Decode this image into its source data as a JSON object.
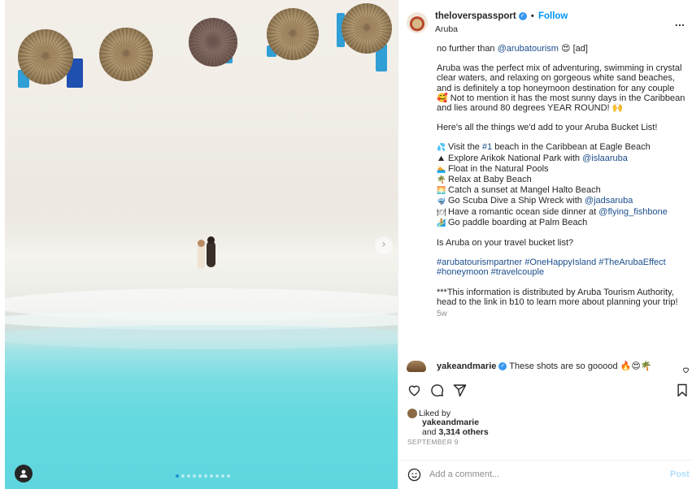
{
  "post": {
    "username": "theloverspassport",
    "follow_label": "Follow",
    "location": "Aruba",
    "more_label": "...",
    "separator": "•"
  },
  "caption": {
    "line0_pre": "no further than ",
    "line0_mention": "@arubatourism",
    "line0_emoji": "😍",
    "line0_post": " [ad]",
    "para1": "Aruba was the perfect mix of adventuring, swimming in crystal clear waters, and relaxing on gorgeous white sand beaches, and is definitely a top honeymoon destination for any couple 🥰 Not to mention it has the most sunny days in the Caribbean and lies around 80 degrees YEAR ROUND! 🙌",
    "para2": "Here's all the things we'd add to your Aruba Bucket List!",
    "bucket_list": [
      {
        "emoji": "💦",
        "pre": "Visit the ",
        "link": "#1",
        "post": " beach in the Caribbean at Eagle Beach"
      },
      {
        "emoji": "⛰",
        "pre": "Explore Arikok National Park with ",
        "link": "@islaaruba",
        "post": ""
      },
      {
        "emoji": "🏊",
        "pre": "Float in the Natural Pools",
        "link": "",
        "post": ""
      },
      {
        "emoji": "🌴",
        "pre": "Relax at Baby Beach",
        "link": "",
        "post": ""
      },
      {
        "emoji": "🌅",
        "pre": "Catch a sunset at Mangel Halto Beach",
        "link": "",
        "post": ""
      },
      {
        "emoji": "🤿",
        "pre": "Go Scuba Dive a Ship Wreck with ",
        "link": "@jadsaruba",
        "post": ""
      },
      {
        "emoji": "🍽",
        "pre": "Have a romantic ocean side dinner at ",
        "link": "@flying_fishbone",
        "post": ""
      },
      {
        "emoji": "🏄",
        "pre": "Go paddle boarding at Palm Beach",
        "link": "",
        "post": ""
      }
    ],
    "question": "Is Aruba on your travel bucket list?",
    "hashtags": "#arubatourismpartner #OneHappyIsland #TheArubaEffect #honeymoon #travelcouple",
    "disclaimer": "***This information is distributed by Aruba Tourism Authority, head to the link in b10 to learn more about planning your trip!",
    "time_ago": "5w"
  },
  "comment": {
    "username": "yakeandmarie",
    "text": "These shots are so gooood 🔥😍🌴"
  },
  "likes": {
    "liked_by_label": "Liked by",
    "liked_user": "yakeandmarie",
    "and_label": "and",
    "count": "3,314 others",
    "date": "SEPTEMBER 9"
  },
  "add_comment": {
    "placeholder": "Add a comment...",
    "post_label": "Post"
  },
  "icons": {
    "like": "heart-icon",
    "comment": "comment-icon",
    "share": "share-icon",
    "save": "bookmark-icon",
    "emoji": "emoji-icon",
    "next": "chevron-right-icon",
    "user_tag": "user-tag-icon",
    "verified": "verified-badge-icon"
  },
  "colors": {
    "link": "#0095f6",
    "verified": "#3897f0",
    "mention": "#1b4e8c",
    "muted": "#8e8e8e",
    "active_dot": "#1c8fd6"
  },
  "carousel": {
    "total_images": 10,
    "active_index": 1
  }
}
